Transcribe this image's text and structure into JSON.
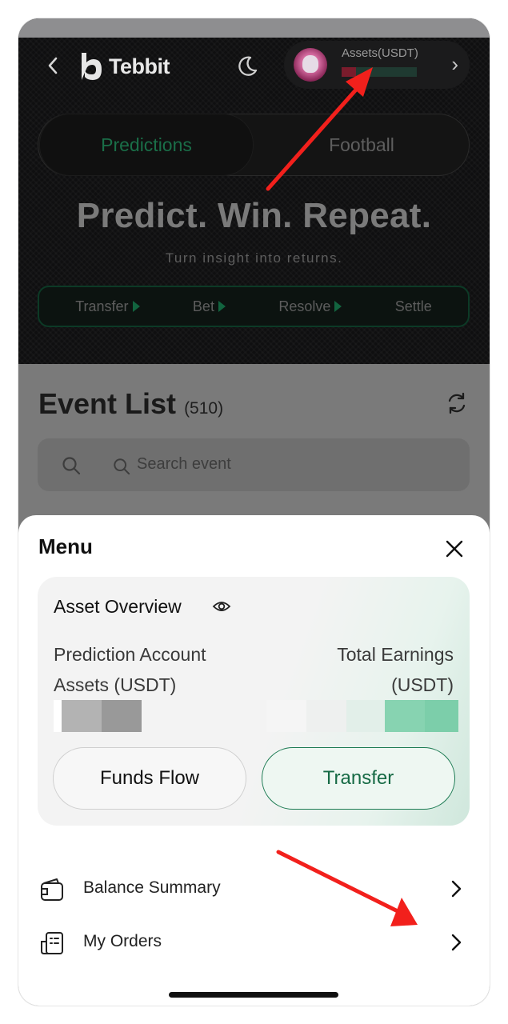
{
  "app": {
    "brand": "Tebbit",
    "assets_label": "Assets(USDT)"
  },
  "hero": {
    "tabs": [
      {
        "label": "Predictions",
        "active": true
      },
      {
        "label": "Football",
        "active": false
      }
    ],
    "headline": "Predict. Win. Repeat.",
    "tagline": "Turn insight into returns.",
    "steps": [
      "Transfer",
      "Bet",
      "Resolve",
      "Settle"
    ]
  },
  "event_list": {
    "title": "Event List",
    "count": "(510)",
    "search_placeholder": "Search event"
  },
  "menu": {
    "title": "Menu",
    "asset_overview": {
      "title": "Asset Overview",
      "prediction_label_line1": "Prediction Account",
      "prediction_label_line2": "Assets (USDT)",
      "earnings_label_line1": "Total Earnings",
      "earnings_label_line2": "(USDT)"
    },
    "funds_flow_label": "Funds Flow",
    "transfer_label": "Transfer",
    "items": [
      {
        "label": "Balance Summary",
        "icon": "wallet-icon"
      },
      {
        "label": "My Orders",
        "icon": "orders-icon"
      }
    ]
  },
  "colors": {
    "accent_green": "#166a45",
    "annotation_red": "#f2201c"
  }
}
